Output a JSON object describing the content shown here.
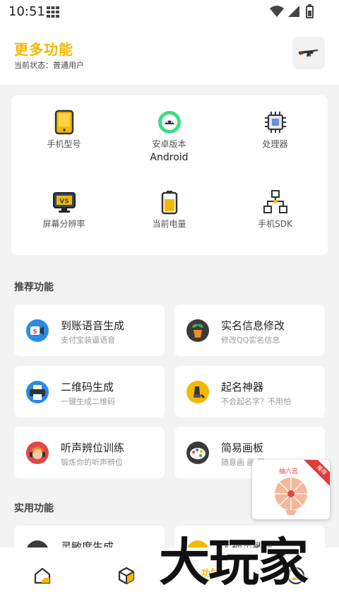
{
  "status_bar": {
    "time": "10:51"
  },
  "header": {
    "title": "更多功能",
    "status_text": "当前状态：普通用户"
  },
  "device_info": [
    {
      "label": "手机型号",
      "value": ""
    },
    {
      "label": "安卓版本",
      "value": "Android"
    },
    {
      "label": "处理器",
      "value": ""
    },
    {
      "label": "屏幕分辨率",
      "value": ""
    },
    {
      "label": "当前电量",
      "value": ""
    },
    {
      "label": "手机SDK",
      "value": ""
    }
  ],
  "sections": {
    "recommended": "推荐功能",
    "practical": "实用功能"
  },
  "recommended": [
    {
      "title": "到账语音生成",
      "subtitle": "支付宝装逼语音"
    },
    {
      "title": "实名信息修改",
      "subtitle": "修改QQ实名信息"
    },
    {
      "title": "二维码生成",
      "subtitle": "一键生成二维码"
    },
    {
      "title": "起名神器",
      "subtitle": "不会起名字？不用怕"
    },
    {
      "title": "听声辨位训练",
      "subtitle": "锻炼你的听声辨位"
    },
    {
      "title": "简易画板",
      "subtitle": "随意画 画 画~"
    }
  ],
  "practical": [
    {
      "title": "灵敏度生成",
      "subtitle": ""
    },
    {
      "title": "大神灵敏度",
      "subtitle": ""
    }
  ],
  "promo": {
    "title": "抽六宫",
    "ribbon": "推荐"
  },
  "bottom_nav": {
    "active_label": "功能"
  },
  "watermark": "大玩家",
  "colors": {
    "accent": "#f5b800",
    "background": "#f3f3f3",
    "card": "#ffffff"
  }
}
